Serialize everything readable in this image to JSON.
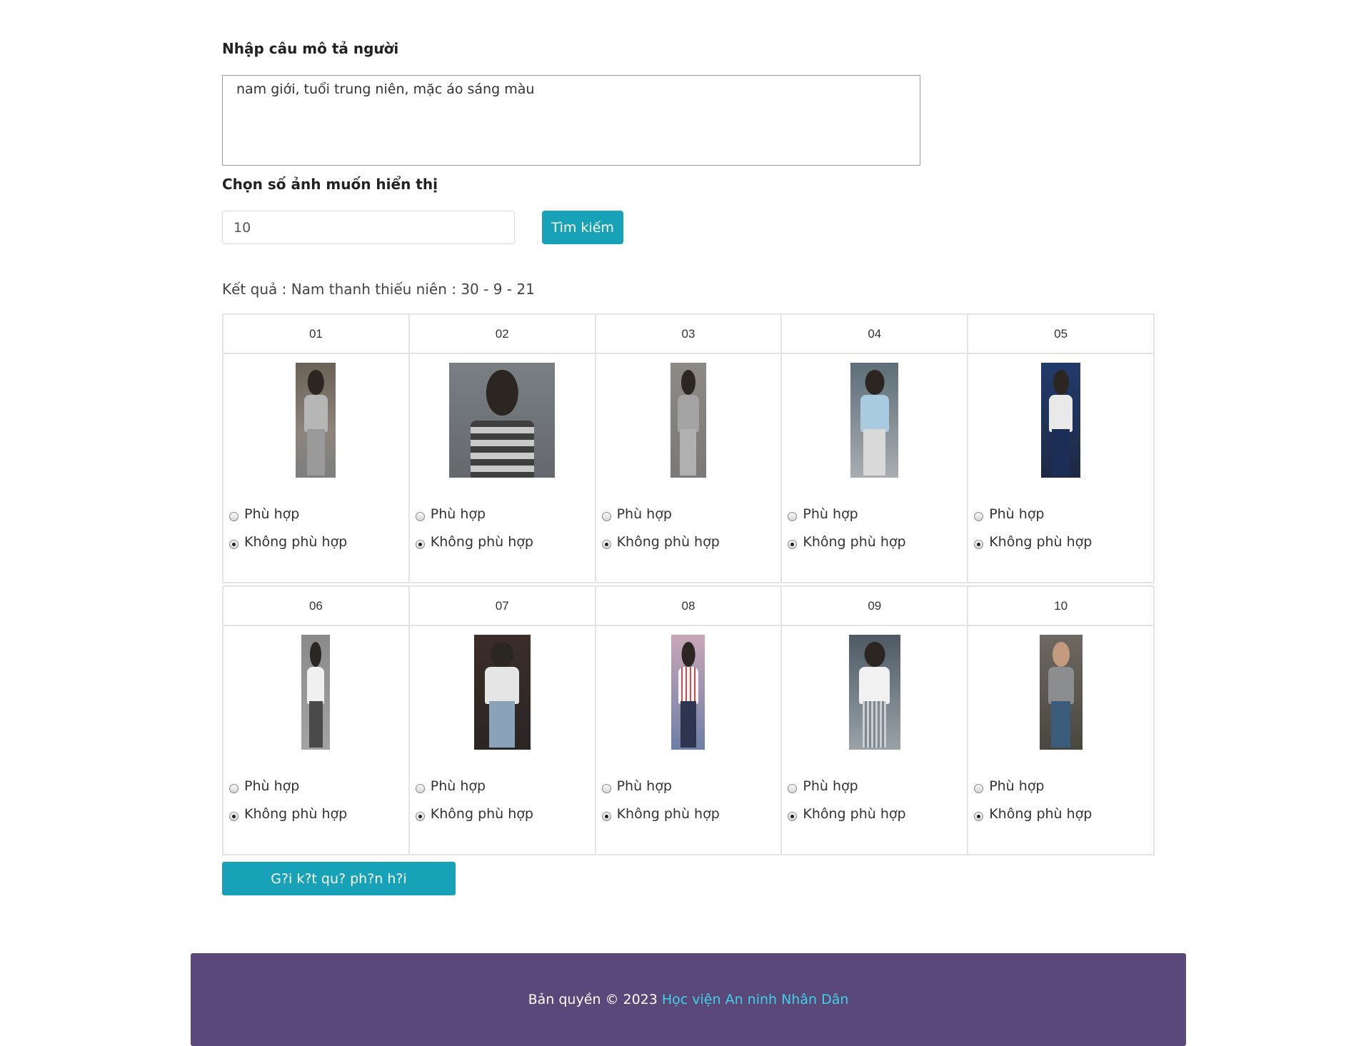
{
  "form": {
    "description_label": "Nhập câu mô tả người",
    "description_value": "nam giới, tuổi trung niên, mặc áo sáng màu",
    "count_label": "Chọn số ảnh muốn hiển thị",
    "count_value": "10",
    "search_label": "Tìm kiếm"
  },
  "result": {
    "text": "Kết quả : Nam thanh thiếu niên : 30 - 9 - 21"
  },
  "options": {
    "match": "Phù hợp",
    "no_match": "Không phù hợp"
  },
  "images": [
    {
      "id": "01",
      "selected": "no_match",
      "icon": "person-photo"
    },
    {
      "id": "02",
      "selected": "no_match",
      "icon": "person-photo"
    },
    {
      "id": "03",
      "selected": "no_match",
      "icon": "person-photo"
    },
    {
      "id": "04",
      "selected": "no_match",
      "icon": "person-photo"
    },
    {
      "id": "05",
      "selected": "no_match",
      "icon": "person-photo"
    },
    {
      "id": "06",
      "selected": "no_match",
      "icon": "person-photo"
    },
    {
      "id": "07",
      "selected": "no_match",
      "icon": "person-photo"
    },
    {
      "id": "08",
      "selected": "no_match",
      "icon": "person-photo"
    },
    {
      "id": "09",
      "selected": "no_match",
      "icon": "person-photo"
    },
    {
      "id": "10",
      "selected": "no_match",
      "icon": "person-photo"
    }
  ],
  "submit": {
    "label": "G?i k?t qu? ph?n h?i"
  },
  "footer": {
    "copyright": "Bản quyền © 2023",
    "link": "Học viện An ninh Nhân Dân"
  },
  "colors": {
    "accent": "#17a2b8",
    "footer_bg": "#5a487a",
    "footer_link": "#3fd1e6"
  }
}
